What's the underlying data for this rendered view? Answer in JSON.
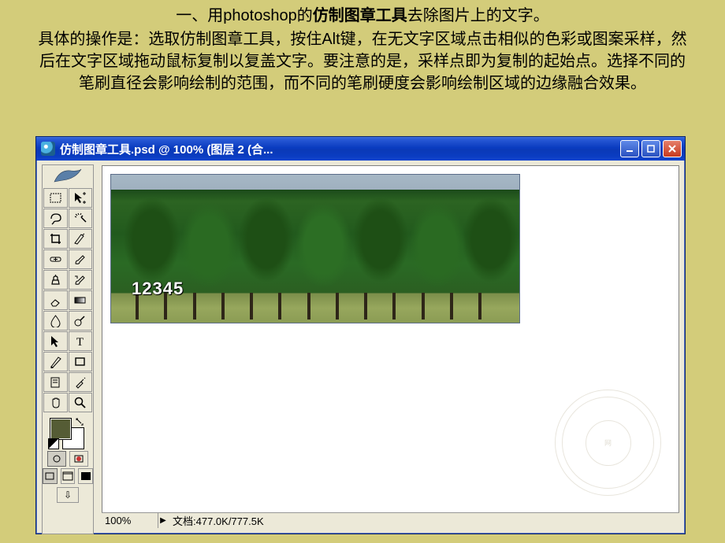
{
  "article": {
    "heading_prefix": "一、用photoshop的",
    "heading_bold": "仿制图章工具",
    "heading_suffix": "去除图片上的文字。",
    "body": "具体的操作是：选取仿制图章工具，按住Alt键，在无文字区域点击相似的色彩或图案采样，然后在文字区域拖动鼠标复制以复盖文字。要注意的是，采样点即为复制的起始点。选择不同的笔刷直径会影响绘制的范围，而不同的笔刷硬度会影响绘制区域的边缘融合效果。"
  },
  "window": {
    "title": "仿制图章工具.psd @ 100% (图层 2 (合...",
    "canvas_text": "12345",
    "status": {
      "zoom": "100%",
      "doc_label": "文档:",
      "doc_value": "477.0K/777.5K"
    },
    "watermark_center": "网"
  },
  "tools": [
    [
      "marquee-rect",
      "move"
    ],
    [
      "lasso",
      "magic-wand"
    ],
    [
      "crop",
      "slice"
    ],
    [
      "healing",
      "brush"
    ],
    [
      "clone-stamp",
      "history-brush"
    ],
    [
      "eraser",
      "gradient"
    ],
    [
      "blur",
      "dodge"
    ],
    [
      "path-select",
      "type"
    ],
    [
      "pen",
      "shape"
    ],
    [
      "notes",
      "eyedropper"
    ],
    [
      "hand",
      "zoom"
    ]
  ]
}
